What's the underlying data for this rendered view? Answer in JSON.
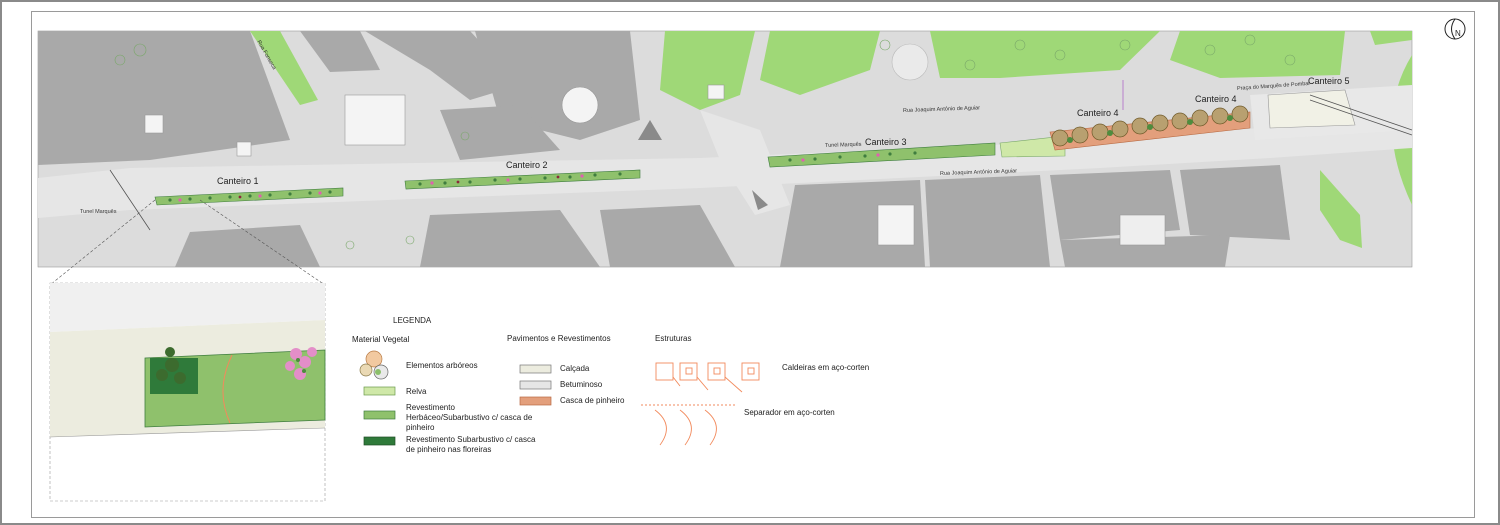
{
  "plan": {
    "beds": [
      {
        "label": "Canteiro 1"
      },
      {
        "label": "Canteiro 2"
      },
      {
        "label": "Canteiro 3"
      },
      {
        "label": "Canteiro 4"
      },
      {
        "label": "Canteiro 5"
      }
    ],
    "streets": {
      "tunel_left": "Tunel Marquês",
      "tunel_right": "Tunel Marquês",
      "rua_top": "Rua Joaquim António de Aguiar",
      "rua_bottom": "Rua Joaquim António de Aguiar",
      "praca": "Praça do Marquês de Pombal",
      "rua_fonseca": "Rua Fonseca"
    },
    "north_letter": "N"
  },
  "legend": {
    "title": "LEGENDA",
    "material_vegetal": {
      "heading": "Material Vegetal",
      "items": [
        {
          "label": "Elementos arbóreos"
        },
        {
          "label": "Relva",
          "color": "#cfe8a8"
        },
        {
          "label": "Revestimento Herbáceo/Subarbustivo c/ casca de pinheiro",
          "color": "#8fc16c"
        },
        {
          "label": "Revestimento Subarbustivo c/ casca de pinheiro nas floreiras",
          "color": "#2f7a3a"
        }
      ]
    },
    "pavimentos": {
      "heading": "Pavimentos e Revestimentos",
      "items": [
        {
          "label": "Calçada",
          "color": "#ececdf"
        },
        {
          "label": "Betuminoso",
          "color": "#e6e6e6"
        },
        {
          "label": "Casca de pinheiro",
          "color": "#e39f7c"
        }
      ]
    },
    "estruturas": {
      "heading": "Estruturas",
      "items": [
        {
          "label": "Caldeiras em aço-corten"
        },
        {
          "label": "Separador em aço-corten"
        }
      ]
    }
  },
  "colors": {
    "building": "#a9a9a9",
    "road": "#dcdcdc",
    "lawn": "#9fd877",
    "bed": "#8fc16c",
    "floreira": "#2f7a3a",
    "corten": "#f28a5c"
  }
}
